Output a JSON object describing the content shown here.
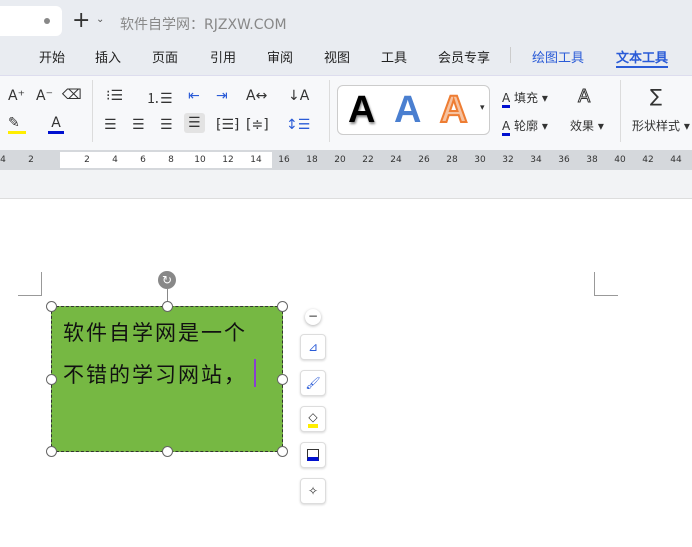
{
  "title_bar": {
    "title": "软件自学网：RJZXW.COM"
  },
  "menu": [
    "开始",
    "插入",
    "页面",
    "引用",
    "审阅",
    "视图",
    "工具",
    "会员专享",
    "绘图工具",
    "文本工具"
  ],
  "active_tab": "文本工具",
  "ribbon": {
    "fill_label": "填充",
    "outline_label": "轮廓",
    "effect_label": "效果",
    "shape_style_label": "形状样式",
    "style_letter": "A"
  },
  "ruler_ticks": [
    "4",
    "2",
    "2",
    "4",
    "6",
    "8",
    "10",
    "12",
    "14",
    "16",
    "18",
    "20",
    "22",
    "24",
    "26",
    "28",
    "30",
    "32",
    "34",
    "36",
    "38",
    "40",
    "42",
    "44"
  ],
  "textbox": {
    "lines": [
      "软件自学网是一个",
      "不错的学习网站，"
    ],
    "fill_color": "#76b843"
  },
  "colors": {
    "accent": "#2a5bd7",
    "highlight": "#ffee00",
    "font_color": "#0010d0"
  }
}
